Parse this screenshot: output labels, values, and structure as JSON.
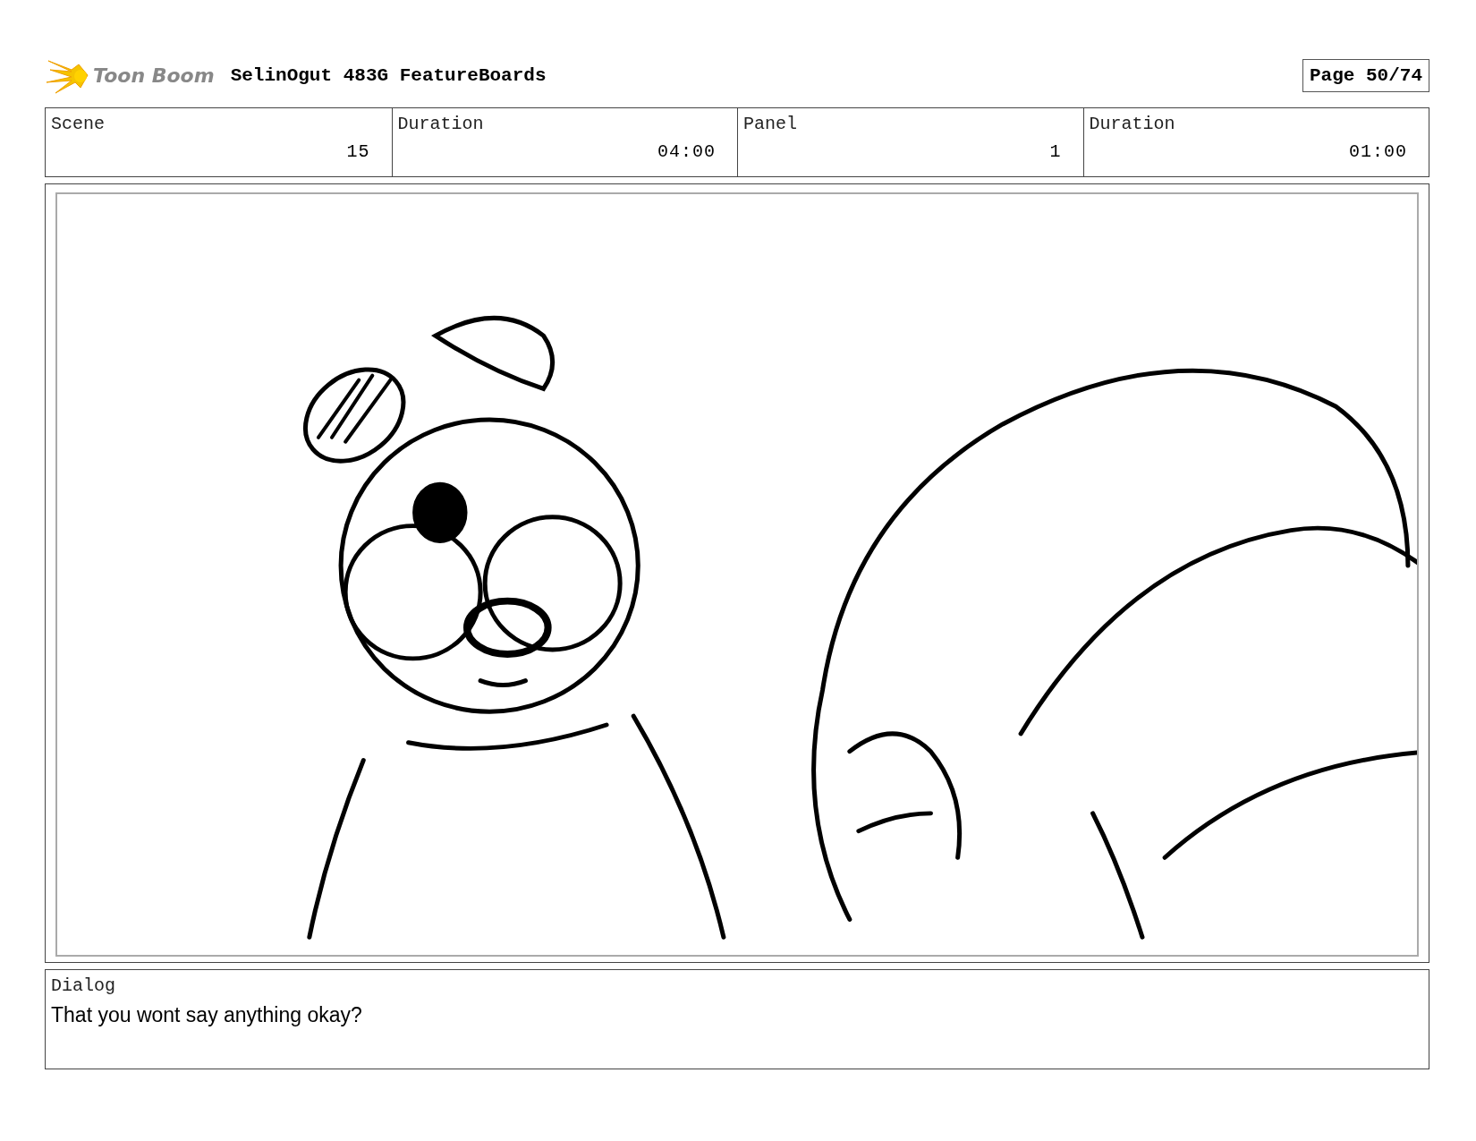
{
  "header": {
    "logo_text": "Toon Boom",
    "project": "SelinOgut 483G FeatureBoards",
    "page": "Page 50/74"
  },
  "info": [
    {
      "label": "Scene",
      "value": "15"
    },
    {
      "label": "Duration",
      "value": "04:00"
    },
    {
      "label": "Panel",
      "value": "1"
    },
    {
      "label": "Duration",
      "value": "01:00"
    }
  ],
  "dialog": {
    "label": "Dialog",
    "text": "That you wont say anything okay?"
  }
}
